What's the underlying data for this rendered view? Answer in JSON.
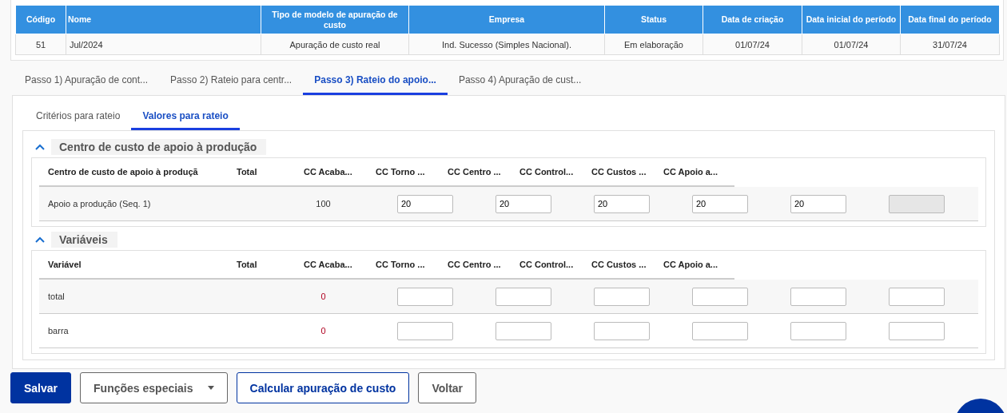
{
  "summary_table": {
    "columns": [
      "Código",
      "Nome",
      "Tipo de modelo de apuração de custo",
      "Empresa",
      "Status",
      "Data de criação",
      "Data inicial do período",
      "Data final do período"
    ],
    "rows": [
      [
        "51",
        "Jul/2024",
        "Apuração de custo real",
        "Ind. Sucesso (Simples Nacional).",
        "Em elaboração",
        "01/07/24",
        "01/07/24",
        "31/07/24"
      ]
    ]
  },
  "step_tabs": [
    {
      "label": "Passo 1) Apuração de cont...",
      "selected": false
    },
    {
      "label": "Passo 2) Rateio para centr...",
      "selected": false
    },
    {
      "label": "Passo 3) Rateio do apoio...",
      "selected": true
    },
    {
      "label": "Passo 4) Apuração de cust...",
      "selected": false
    }
  ],
  "sub_tabs": [
    {
      "label": "Critérios para rateio",
      "selected": false
    },
    {
      "label": "Valores para rateio",
      "selected": true
    }
  ],
  "sections": [
    {
      "title": "Centro de custo de apoio à produção",
      "expanded": true,
      "columns": [
        "Centro de custo de apoio à produçã",
        "Total",
        "CC Acaba...",
        "CC Torno ...",
        "CC Centro ...",
        "CC Control...",
        "CC Custos ...",
        "CC Apoio a..."
      ],
      "rows": [
        {
          "label": "Apoio a produção (Seq. 1)",
          "total": "100",
          "warning": false,
          "inputs": [
            {
              "value": "20",
              "disabled": false
            },
            {
              "value": "20",
              "disabled": false
            },
            {
              "value": "20",
              "disabled": false
            },
            {
              "value": "20",
              "disabled": false
            },
            {
              "value": "20",
              "disabled": false
            },
            {
              "disabled": true
            }
          ]
        }
      ]
    },
    {
      "title": "Variáveis",
      "expanded": true,
      "columns": [
        "Variável",
        "Total",
        "CC Acaba...",
        "CC Torno ...",
        "CC Centro ...",
        "CC Control...",
        "CC Custos ...",
        "CC Apoio a..."
      ],
      "rows": [
        {
          "label": "total",
          "total": "0",
          "warning": true,
          "inputs": [
            {
              "disabled": false
            },
            {
              "disabled": false
            },
            {
              "disabled": false
            },
            {
              "disabled": false
            },
            {
              "disabled": false
            },
            {
              "disabled": false
            }
          ]
        },
        {
          "label": "barra",
          "total": "0",
          "warning": true,
          "inputs": [
            {
              "disabled": false
            },
            {
              "disabled": false
            },
            {
              "disabled": false
            },
            {
              "disabled": false
            },
            {
              "disabled": false
            },
            {
              "disabled": false
            }
          ]
        }
      ]
    }
  ],
  "buttons": [
    {
      "label": "Salvar",
      "kind": "primary"
    },
    {
      "label": "Funções especiais",
      "kind": "dropdown"
    },
    {
      "label": "Calcular apuração de custo",
      "kind": "outline"
    },
    {
      "label": "Voltar",
      "kind": "default"
    }
  ]
}
